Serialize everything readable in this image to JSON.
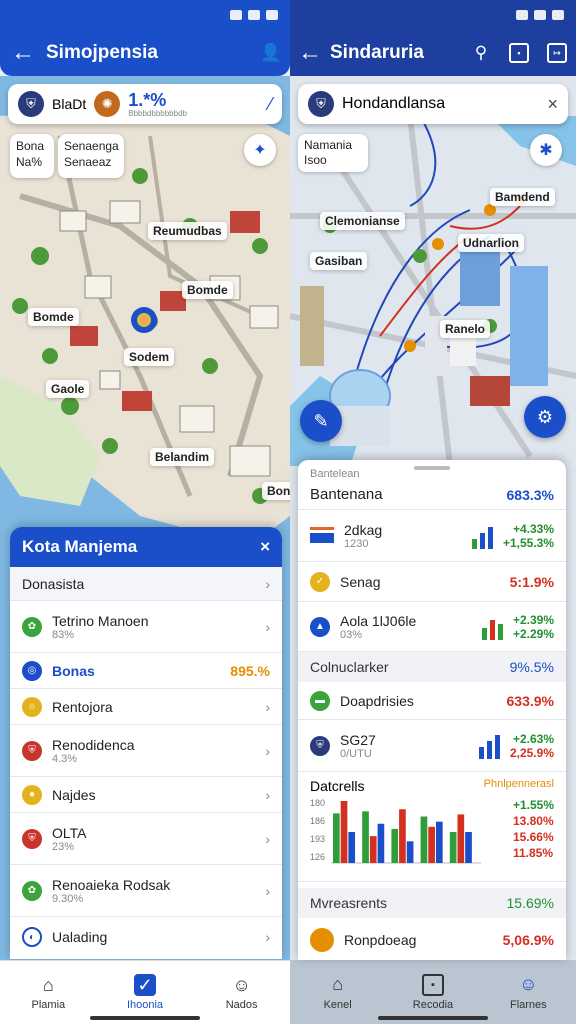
{
  "left": {
    "appbar": {
      "title": "Simojpensia"
    },
    "topcard": {
      "label": "BlaDt",
      "value": "1.*%",
      "sub": "Bbbbdbbbbbbdb"
    },
    "map_labels": [
      "Bona",
      "Na%",
      "Senaenga",
      "Senaeaz",
      "Reumudbas",
      "Bomde",
      "Sodem",
      "Gaole",
      "Belandim",
      "Bonandm"
    ],
    "sheet": {
      "title": "Kota Manjema",
      "rows": [
        {
          "label": "Donasista"
        },
        {
          "label": "Tetrino Manoen",
          "sub": "83%"
        },
        {
          "label": "Bonas",
          "value": "895.%"
        },
        {
          "label": "Rentojora"
        },
        {
          "label": "Renodidenca",
          "sub": "4.3%"
        },
        {
          "label": "Najdes"
        },
        {
          "label": "OLTA",
          "sub": "23%"
        },
        {
          "label": "Renoaieka Rodsak",
          "sub": "9.30%"
        },
        {
          "label": "Ualading"
        }
      ]
    },
    "nav": [
      {
        "label": "Plamia",
        "icon": "home-icon"
      },
      {
        "label": "Ihoonia",
        "icon": "chart-icon"
      },
      {
        "label": "Nados",
        "icon": "person-icon"
      }
    ]
  },
  "right": {
    "appbar": {
      "title": "Sindaruria"
    },
    "panel_title": "Hondandlansa",
    "map_labels": [
      "Namania",
      "Isoo",
      "Clemonianse",
      "Gasiban",
      "Bamdend",
      "Udnarlion",
      "Ranelo"
    ],
    "sheet": {
      "tag": "Bantelean",
      "header": {
        "label": "Bantenana",
        "value": "683.3%"
      },
      "rows": [
        {
          "label": "2dkag",
          "sub": "1230",
          "v1": "+4.33%",
          "v2": "+1,55.3%"
        },
        {
          "label": "Senag",
          "value": "5:1.9%"
        },
        {
          "label": "Aola 1lJ06le",
          "sub": "03%",
          "v1": "+2.39%",
          "v2": "+2.29%"
        }
      ],
      "section2": {
        "label": "Colnuclarker",
        "value": "9%.5%"
      },
      "rows2": [
        {
          "label": "Doapdrisies",
          "value": "633.9%"
        },
        {
          "label": "SG27",
          "sub": "0/UTU",
          "v1": "+2.63%",
          "v2": "2,25.9%"
        }
      ],
      "chart_block": {
        "label": "Datcrells",
        "tag": "Phnlpennerasl",
        "values": [
          "+1.55%",
          "13.80%",
          "15.66%",
          "11.85%"
        ],
        "y_ticks": [
          "180",
          "186",
          "193",
          "126"
        ],
        "chart_data": {
          "type": "bar",
          "series": [
            {
              "name": "",
              "color": "#2e9e3b",
              "values": [
                48,
                50,
                33,
                45,
                30
              ]
            },
            {
              "name": "",
              "color": "#d3301f",
              "values": [
                60,
                26,
                52,
                35,
                47
              ]
            },
            {
              "name": "",
              "color": "#1a4fc9",
              "values": [
                30,
                38,
                21,
                40,
                30
              ]
            }
          ]
        }
      },
      "section3": {
        "label": "Mvreasrents",
        "value": "15.69%"
      },
      "rows3": [
        {
          "label": "Ronpdoeag",
          "value": "5,06.9%"
        }
      ]
    },
    "nav": [
      {
        "label": "Kenel",
        "icon": "home-icon"
      },
      {
        "label": "Recodia",
        "icon": "chart-icon"
      },
      {
        "label": "Flarnes",
        "icon": "person-icon"
      }
    ]
  }
}
